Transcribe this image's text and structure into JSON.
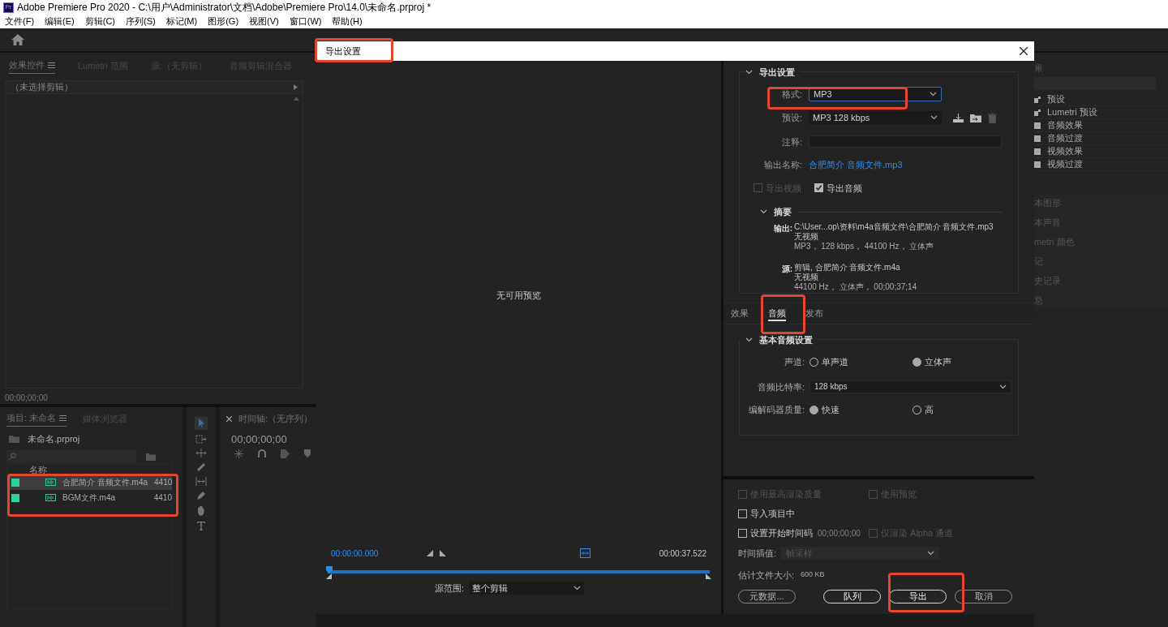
{
  "app": {
    "logo": "Pr",
    "title": "Adobe Premiere Pro 2020 - C:\\用户\\Administrator\\文档\\Adobe\\Premiere Pro\\14.0\\未命名.prproj *",
    "menu": [
      "文件(F)",
      "编辑(E)",
      "剪辑(C)",
      "序列(S)",
      "标记(M)",
      "图形(G)",
      "视图(V)",
      "窗口(W)",
      "帮助(H)"
    ]
  },
  "effect_controls": {
    "tabs": [
      {
        "label": "效果控件",
        "selected": true
      },
      {
        "label": "Lumetri 范围",
        "selected": false
      },
      {
        "label": "源:（无剪辑）",
        "selected": false
      },
      {
        "label": "音频剪辑混合器",
        "selected": false
      }
    ],
    "clip_header": "（未选择剪辑）",
    "timecode": "00;00;00;00"
  },
  "project": {
    "tabs": [
      {
        "label": "项目: 未命名",
        "selected": true
      },
      {
        "label": "媒体浏览器",
        "selected": false
      }
    ],
    "file": "未命名.prproj",
    "column_name": "名称",
    "items": [
      {
        "name": "合肥简介 音频文件.m4a",
        "rate": "4410",
        "color": "#2ed39a",
        "selected": true
      },
      {
        "name": "BGM文件.m4a",
        "rate": "4410",
        "color": "#2ed39a",
        "selected": false
      }
    ]
  },
  "timeline": {
    "title": "时间轴:（无序列）",
    "timecode": "00;00;00;00"
  },
  "effects_panel": {
    "title": "果",
    "items": [
      {
        "label": "预设",
        "kind": "preset"
      },
      {
        "label": "Lumetri 预设",
        "kind": "preset"
      },
      {
        "label": "音频效果",
        "kind": "folder"
      },
      {
        "label": "音频过渡",
        "kind": "folder"
      },
      {
        "label": "视频效果",
        "kind": "folder"
      },
      {
        "label": "视频过渡",
        "kind": "folder"
      }
    ],
    "sections": [
      "本图形",
      "本声音",
      "metri 颜色",
      "记",
      "史记录",
      "息"
    ]
  },
  "dialog": {
    "title": "导出设置",
    "preview_message": "无可用预览",
    "start_time": "00:00:00.000",
    "end_time": "00:00:37.522",
    "source_range_label": "源范围:",
    "source_range_value": "整个剪辑",
    "export_settings": {
      "heading": "导出设置",
      "format_label": "格式:",
      "format_value": "MP3",
      "preset_label": "预设:",
      "preset_value": "MP3 128 kbps",
      "comment_label": "注释:",
      "output_name_label": "输出名称:",
      "output_name": "合肥简介 音频文件.mp3",
      "checks": [
        {
          "label": "导出视频",
          "checked": false,
          "disabled": true
        },
        {
          "label": "导出音频",
          "checked": true,
          "disabled": false
        }
      ],
      "summary": {
        "heading": "摘要",
        "groups": [
          {
            "label": "输出:",
            "lines": [
              "C:\\User...op\\资料\\m4a音频文件\\合肥简介 音频文件.mp3",
              "无视频",
              "MP3， 128 kbps， 44100 Hz， 立体声"
            ]
          },
          {
            "label": "源:",
            "lines": [
              "剪辑, 合肥简介 音频文件.m4a",
              "无视频",
              "44100 Hz， 立体声， 00;00;37;14"
            ]
          }
        ]
      }
    },
    "tabs": [
      {
        "label": "效果",
        "selected": false
      },
      {
        "label": "音频",
        "selected": true
      },
      {
        "label": "发布",
        "selected": false
      }
    ],
    "audio": {
      "heading": "基本音频设置",
      "channels_label": "声道:",
      "channels": [
        {
          "label": "单声道",
          "selected": false
        },
        {
          "label": "立体声",
          "selected": true
        }
      ],
      "bitrate_label": "音频比特率:",
      "bitrate_value": "128 kbps",
      "codec_label": "编解码器质量:",
      "codec": [
        {
          "label": "快速",
          "selected": true
        },
        {
          "label": "高",
          "selected": false
        }
      ]
    },
    "option_rows": [
      [
        {
          "label": "使用最高渲染质量",
          "checked": false,
          "disabled": true
        },
        {
          "label": "使用预览",
          "checked": false,
          "disabled": true
        }
      ],
      [
        {
          "label": "导入项目中",
          "checked": false,
          "disabled": false
        }
      ],
      [
        {
          "label": "设置开始时间码",
          "checked": false,
          "disabled": false,
          "value": "00;00;00;00"
        },
        {
          "label": "仅渲染 Alpha 通道",
          "checked": false,
          "disabled": true
        }
      ]
    ],
    "interpolation_label": "时间插值:",
    "interpolation_value": "帧采样",
    "filesize_label": "估计文件大小:",
    "filesize_value": "600 KB",
    "buttons": [
      {
        "label": "元数据...",
        "kind": "secondary"
      },
      {
        "label": "队列",
        "kind": "primary"
      },
      {
        "label": "导出",
        "kind": "primary"
      },
      {
        "label": "取消",
        "kind": "secondary"
      }
    ]
  }
}
